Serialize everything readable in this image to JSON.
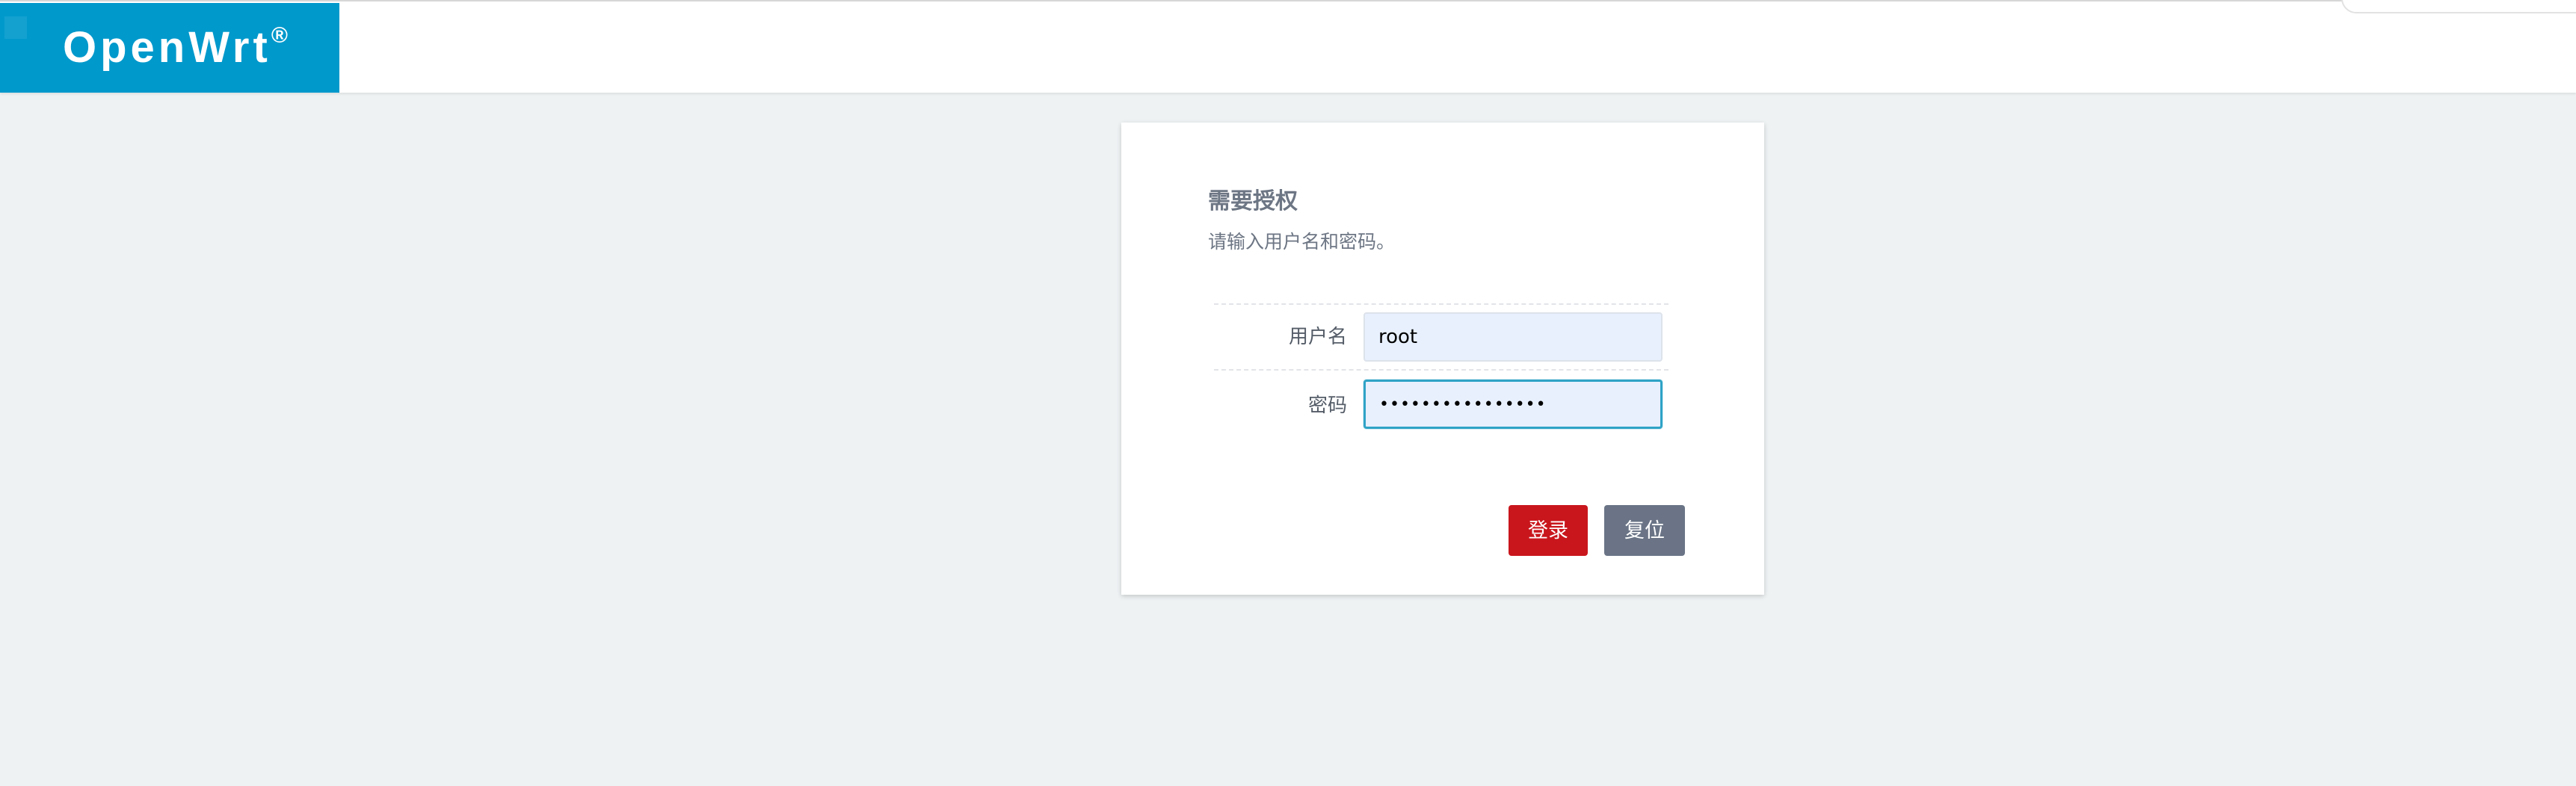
{
  "header": {
    "brand": "OpenWrt",
    "brand_mark": "®"
  },
  "login": {
    "title": "需要授权",
    "subtitle": "请输入用户名和密码。",
    "username_label": "用户名",
    "username_value": "root",
    "password_label": "密码",
    "password_value": "••••••••••••••••",
    "login_button": "登录",
    "reset_button": "复位"
  },
  "colors": {
    "brand_blue": "#0099cc",
    "login_red": "#c9161d",
    "reset_gray": "#6a7486",
    "page_background": "#eef2f3"
  }
}
